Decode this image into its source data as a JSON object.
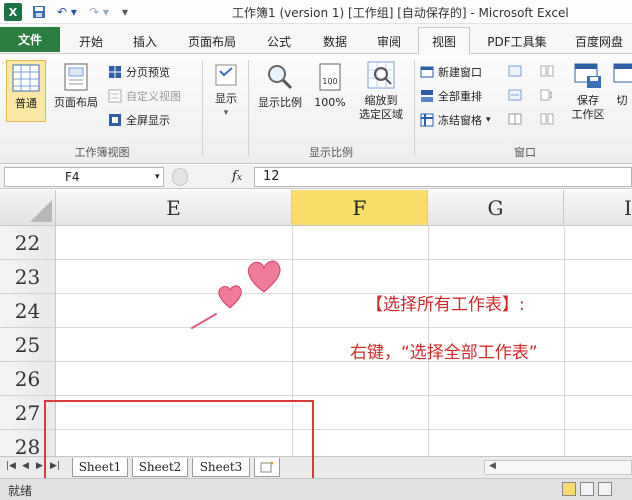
{
  "window": {
    "title": "工作簿1 (version 1) [工作组] [自动保存的] - Microsoft Excel"
  },
  "quick_access": {
    "save_icon": "save-icon",
    "undo_icon": "undo-icon",
    "redo_icon": "redo-icon",
    "customize_icon": "dropdown-icon"
  },
  "ribbon_tabs": [
    "文件",
    "开始",
    "插入",
    "页面布局",
    "公式",
    "数据",
    "审阅",
    "视图",
    "PDF工具集",
    "百度网盘"
  ],
  "active_tab": "视图",
  "ribbon": {
    "workbook_views": {
      "label": "工作簿视图",
      "normal": "普通",
      "page_layout": "页面布局",
      "page_break_preview": "分页预览",
      "custom_views": "自定义视图",
      "full_screen": "全屏显示"
    },
    "show": {
      "label": "显示"
    },
    "zoom": {
      "label": "显示比例",
      "zoom_button": "显示比例",
      "zoom_100": "100%",
      "zoom_to_selection_line1": "缩放到",
      "zoom_to_selection_line2": "选定区域"
    },
    "window": {
      "label": "窗口",
      "new_window": "新建窗口",
      "arrange_all": "全部重排",
      "freeze_panes": "冻结窗格",
      "save_workspace_line1": "保存",
      "save_workspace_line2": "工作区",
      "switch_windows": "切"
    }
  },
  "formula_bar": {
    "name_box": "F4",
    "fx_label": "fx",
    "value": "12"
  },
  "columns": [
    "E",
    "F",
    "G",
    "I"
  ],
  "selected_column": "F",
  "rows": [
    "22",
    "23",
    "24",
    "25",
    "26",
    "27",
    "28"
  ],
  "annotations": {
    "heading": "【选择所有工作表】:",
    "instruction": "右键，“选择全部工作表”"
  },
  "sheets": [
    "Sheet1",
    "Sheet2",
    "Sheet3"
  ],
  "status_bar": {
    "mode": "就绪"
  },
  "colors": {
    "file_tab": "#2b7c3f",
    "selected_column": "#f8dd6a",
    "annotation": "#d02a2a",
    "highlight_box": "#d93a3a"
  }
}
